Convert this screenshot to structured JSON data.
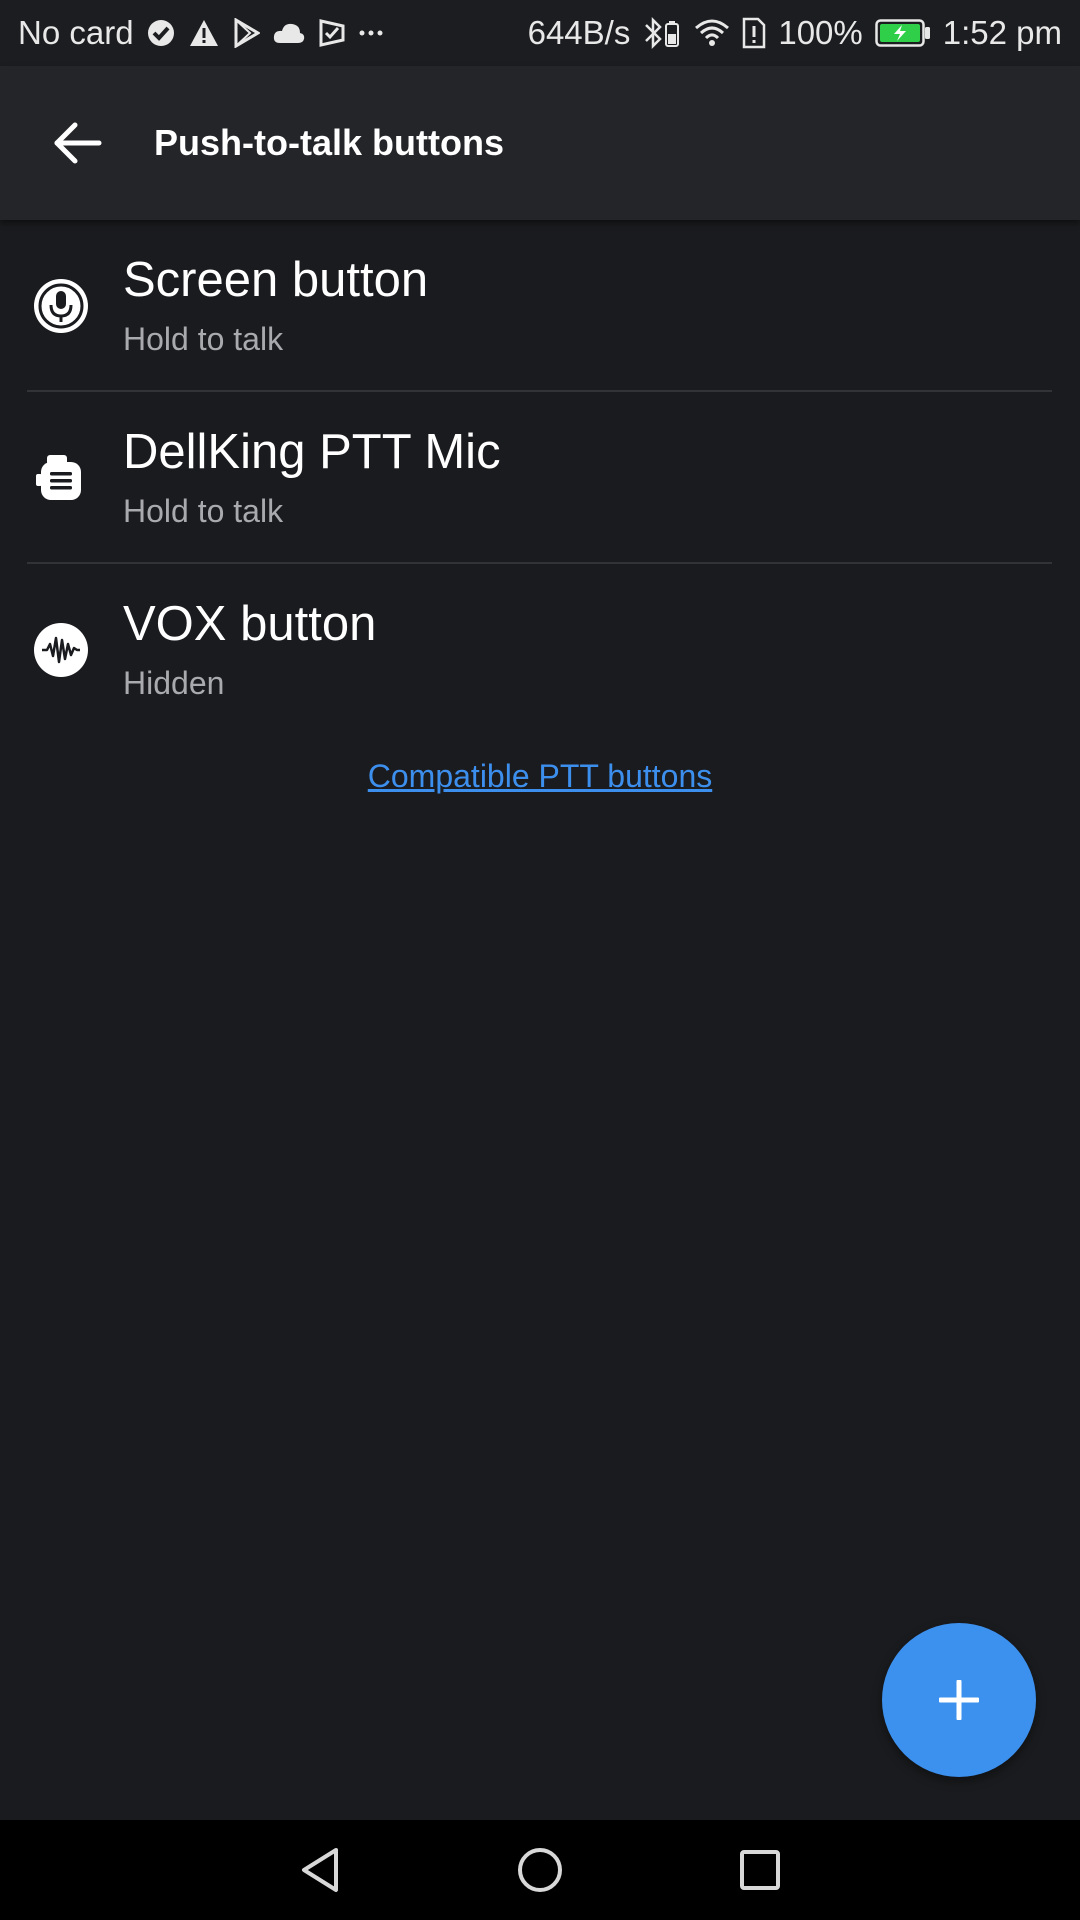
{
  "status_bar": {
    "carrier": "No card",
    "left_icons": [
      "check-shield-icon",
      "warning-icon",
      "play-store-icon",
      "cloud-icon",
      "check-badge-icon",
      "more-dots-icon"
    ],
    "network_speed": "644B/s",
    "battery_percent": "100%",
    "time": "1:52 pm"
  },
  "appbar": {
    "title": "Push-to-talk buttons"
  },
  "items": [
    {
      "title": "Screen button",
      "subtitle": "Hold to talk",
      "icon": "microphone-circle-icon"
    },
    {
      "title": "DellKing PTT Mic",
      "subtitle": "Hold to talk",
      "icon": "ptt-mic-icon"
    },
    {
      "title": "VOX button",
      "subtitle": "Hidden",
      "icon": "waveform-icon"
    }
  ],
  "link": {
    "label": "Compatible PTT buttons"
  },
  "colors": {
    "background": "#1a1b1e",
    "appbar": "#242528",
    "accent": "#3c90ee",
    "secondary_text": "#a9aaad"
  }
}
